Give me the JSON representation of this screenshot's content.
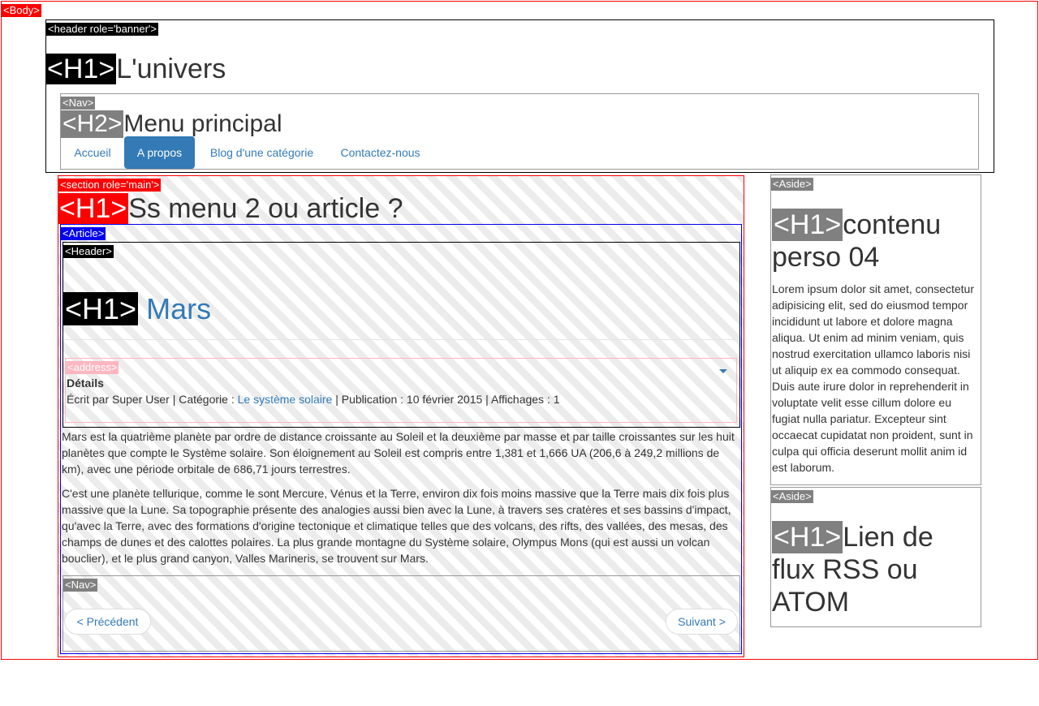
{
  "tags": {
    "body": "<Body>",
    "banner": "<header role='banner'>",
    "h1": "<H1>",
    "h2": "<H2>",
    "nav": "<Nav>",
    "main_section": "<section role='main'>",
    "article": "<Article>",
    "header": "<Header>",
    "h1_article": "<H1>",
    "address": "<address>",
    "aside": "<Aside>"
  },
  "banner": {
    "title": "L'univers"
  },
  "nav": {
    "heading": "Menu principal",
    "items": [
      {
        "label": "Accueil",
        "active": false
      },
      {
        "label": "A propos",
        "active": true
      },
      {
        "label": "Blog d'une catégorie",
        "active": false
      },
      {
        "label": "Contactez-nous",
        "active": false
      }
    ]
  },
  "main": {
    "heading": "Ss menu 2 ou article ?",
    "article": {
      "title": "Mars",
      "details_label": "Détails",
      "meta_prefix": "Écrit par Super User | Catégorie : ",
      "category": "Le système solaire",
      "meta_suffix": " | Publication : 10 février 2015 | Affichages : 1",
      "paragraph1": "Mars est la quatrième planète par ordre de distance croissante au Soleil et la deuxième par masse et par taille croissantes sur les huit planètes que compte le Système solaire. Son éloignement au Soleil est compris entre 1,381 et 1,666 UA (206,6 à 249,2 millions de km), avec une période orbitale de 686,71 jours terrestres.",
      "paragraph2": "C'est une planète tellurique, comme le sont Mercure, Vénus et la Terre, environ dix fois moins massive que la Terre mais dix fois plus massive que la Lune. Sa topographie présente des analogies aussi bien avec la Lune, à travers ses cratères et ses bassins d'impact, qu'avec la Terre, avec des formations d'origine tectonique et climatique telles que des volcans, des rifts, des vallées, des mesas, des champs de dunes et des calottes polaires. La plus grande montagne du Système solaire, Olympus Mons (qui est aussi un volcan bouclier), et le plus grand canyon, Valles Marineris, se trouvent sur Mars.",
      "prev_label": "< Précédent",
      "next_label": "Suivant >"
    }
  },
  "aside1": {
    "title": "contenu perso 04",
    "text": "Lorem ipsum dolor sit amet, consectetur adipisicing elit, sed do eiusmod tempor incididunt ut labore et dolore magna aliqua. Ut enim ad minim veniam, quis nostrud exercitation ullamco laboris nisi ut aliquip ex ea commodo consequat. Duis aute irure dolor in reprehenderit in voluptate velit esse cillum dolore eu fugiat nulla pariatur. Excepteur sint occaecat cupidatat non proident, sunt in culpa qui officia deserunt mollit anim id est laborum."
  },
  "aside2": {
    "title": "Lien de flux RSS ou ATOM"
  },
  "colors": {
    "link": "#337ab7",
    "body_outline": "#ff0000",
    "article_outline": "#0000ee"
  },
  "icons": {
    "details_toggle": "caret-down-icon"
  }
}
